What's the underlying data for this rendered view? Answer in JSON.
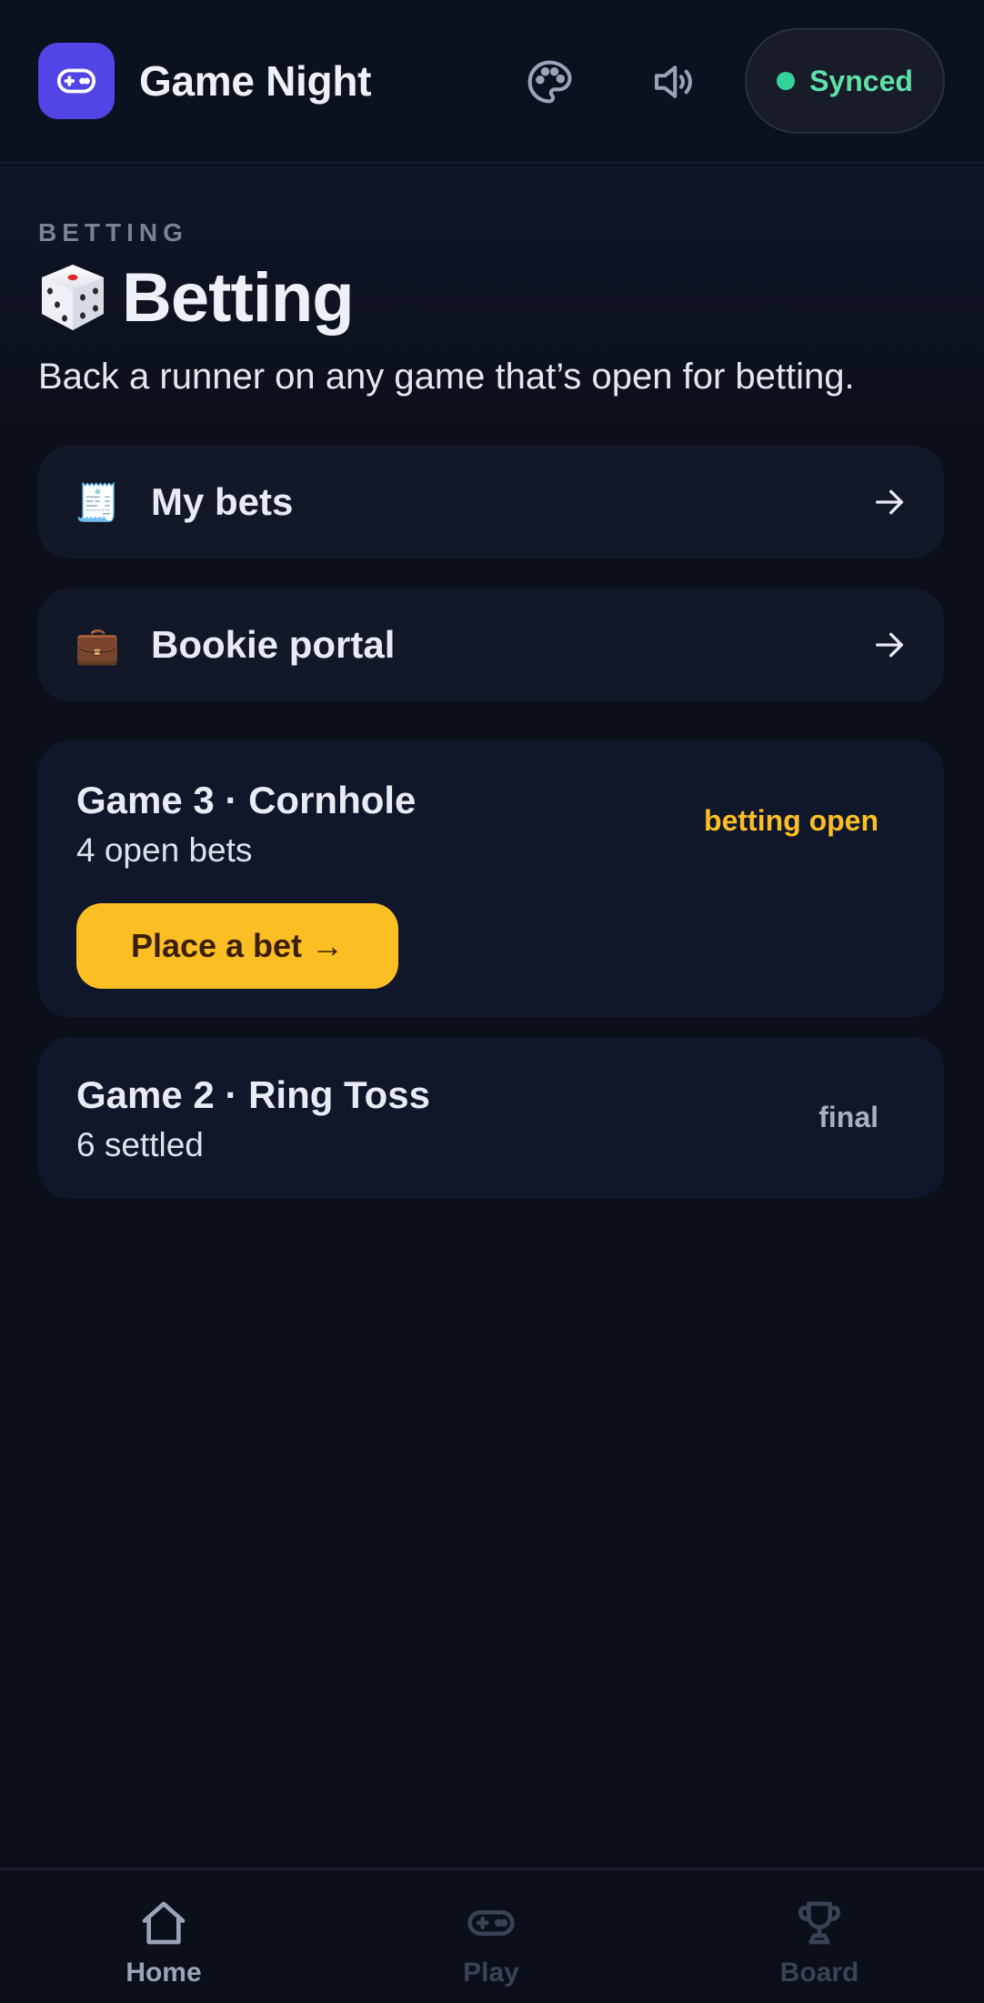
{
  "header": {
    "app_title": "Game Night",
    "logo_icon": "gamepad-icon",
    "palette_icon": "palette-icon",
    "sound_icon": "speaker-icon",
    "sync_label": "Synced",
    "sync_color": "#34d399"
  },
  "hero": {
    "eyebrow": "BETTING",
    "title_emoji": "🎲",
    "title": "Betting",
    "subtitle": "Back a runner on any game that’s open for betting."
  },
  "links": [
    {
      "emoji": "🧾",
      "label": "My bets",
      "icon": "arrow-right-icon"
    },
    {
      "emoji": "💼",
      "label": "Bookie portal",
      "icon": "arrow-right-icon"
    }
  ],
  "games": [
    {
      "title": "Game 3 · Cornhole",
      "subtitle": "4 open bets",
      "status": "betting open",
      "status_color": "#fbbf24",
      "action_label": "Place a bet →"
    },
    {
      "title": "Game 2 · Ring Toss",
      "subtitle": "6 settled",
      "status": "final",
      "status_color": "#a7afc2"
    }
  ],
  "bottom_nav": [
    {
      "label": "Home",
      "icon": "home-icon",
      "active": true
    },
    {
      "label": "Play",
      "icon": "gamepad-icon",
      "active": false
    },
    {
      "label": "Board",
      "icon": "trophy-icon",
      "active": false
    }
  ],
  "colors": {
    "background": "#0b0f19",
    "accent": "#5145e5",
    "cta": "#fbbf24"
  }
}
